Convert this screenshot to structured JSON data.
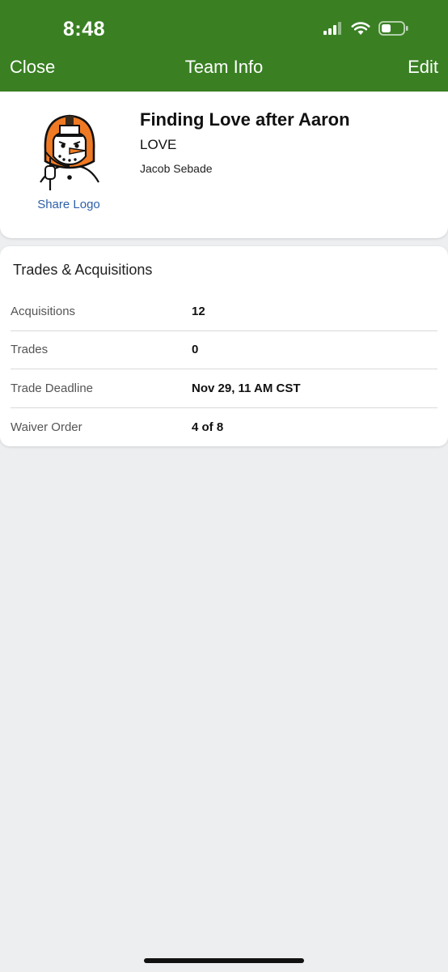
{
  "status_bar": {
    "time": "8:48",
    "signal_icon": "cellular-signal-icon",
    "wifi_icon": "wifi-icon",
    "battery_icon": "battery-icon",
    "battery_level": 0.35
  },
  "nav": {
    "close_label": "Close",
    "title": "Team Info",
    "edit_label": "Edit"
  },
  "team": {
    "logo_icon": "snowman-helmet-logo",
    "share_logo_label": "Share Logo",
    "name": "Finding Love after Aaron",
    "abbrev": "LOVE",
    "owner": "Jacob Sebade"
  },
  "trades": {
    "title": "Trades & Acquisitions",
    "rows": [
      {
        "label": "Acquisitions",
        "value": "12"
      },
      {
        "label": "Trades",
        "value": "0"
      },
      {
        "label": "Trade Deadline",
        "value": "Nov 29, 11 AM CST"
      },
      {
        "label": "Waiver Order",
        "value": "4 of 8"
      }
    ]
  },
  "colors": {
    "header_green": "#3a8023",
    "link_blue": "#2e5fa8",
    "background": "#eceef0"
  }
}
